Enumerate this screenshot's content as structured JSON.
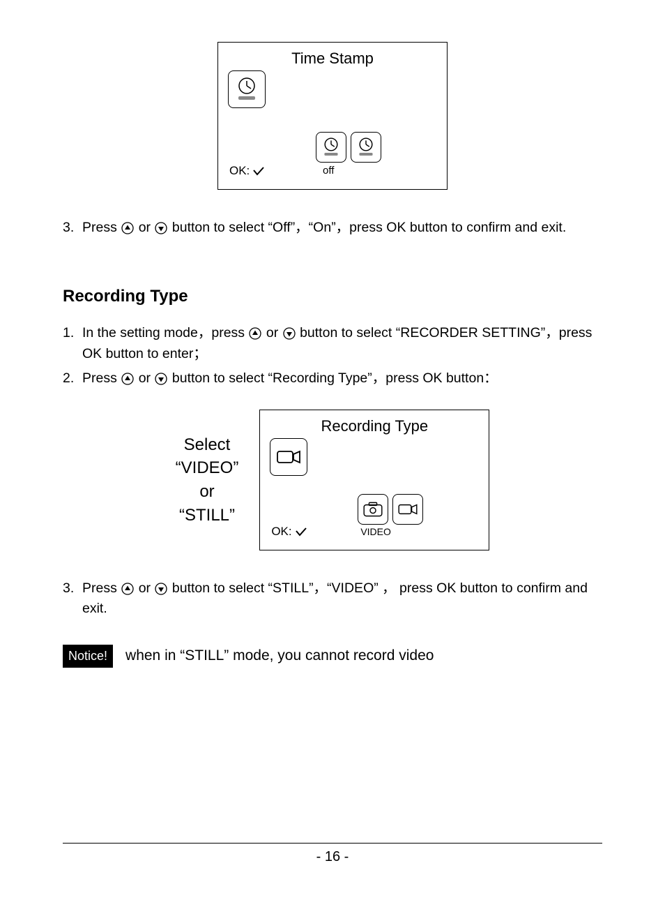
{
  "panel1": {
    "title": "Time Stamp",
    "ok_prefix": "OK:",
    "option_label": "off"
  },
  "section1": {
    "step3_num": "3.",
    "step3_a": "Press ",
    "step3_b": " or ",
    "step3_c": " button to select “Off”，“On”，press OK button to confirm and exit."
  },
  "heading": "Recording Type",
  "section2": {
    "step1_num": "1.",
    "step1_a": "In the setting mode，press ",
    "step1_b": " or ",
    "step1_c": " button to select “RECORDER SETTING”，press OK button to enter；",
    "step2_num": "2.",
    "step2_a": "Press ",
    "step2_b": " or ",
    "step2_c": " button to select “Recording Type”，press OK button："
  },
  "side_label": {
    "l1": "Select",
    "l2": "“VIDEO”",
    "l3": "or",
    "l4": "“STILL”"
  },
  "panel2": {
    "title": "Recording Type",
    "ok_prefix": "OK:",
    "option_label": "VIDEO"
  },
  "section3": {
    "step3_num": "3.",
    "step3_a": "Press ",
    "step3_b": " or ",
    "step3_c": " button to select “STILL”，“VIDEO” ， press OK button to confirm and exit."
  },
  "notice": {
    "badge": "Notice!",
    "text": "when in “STILL” mode, you  cannot record video"
  },
  "page_num": "- 16 -"
}
